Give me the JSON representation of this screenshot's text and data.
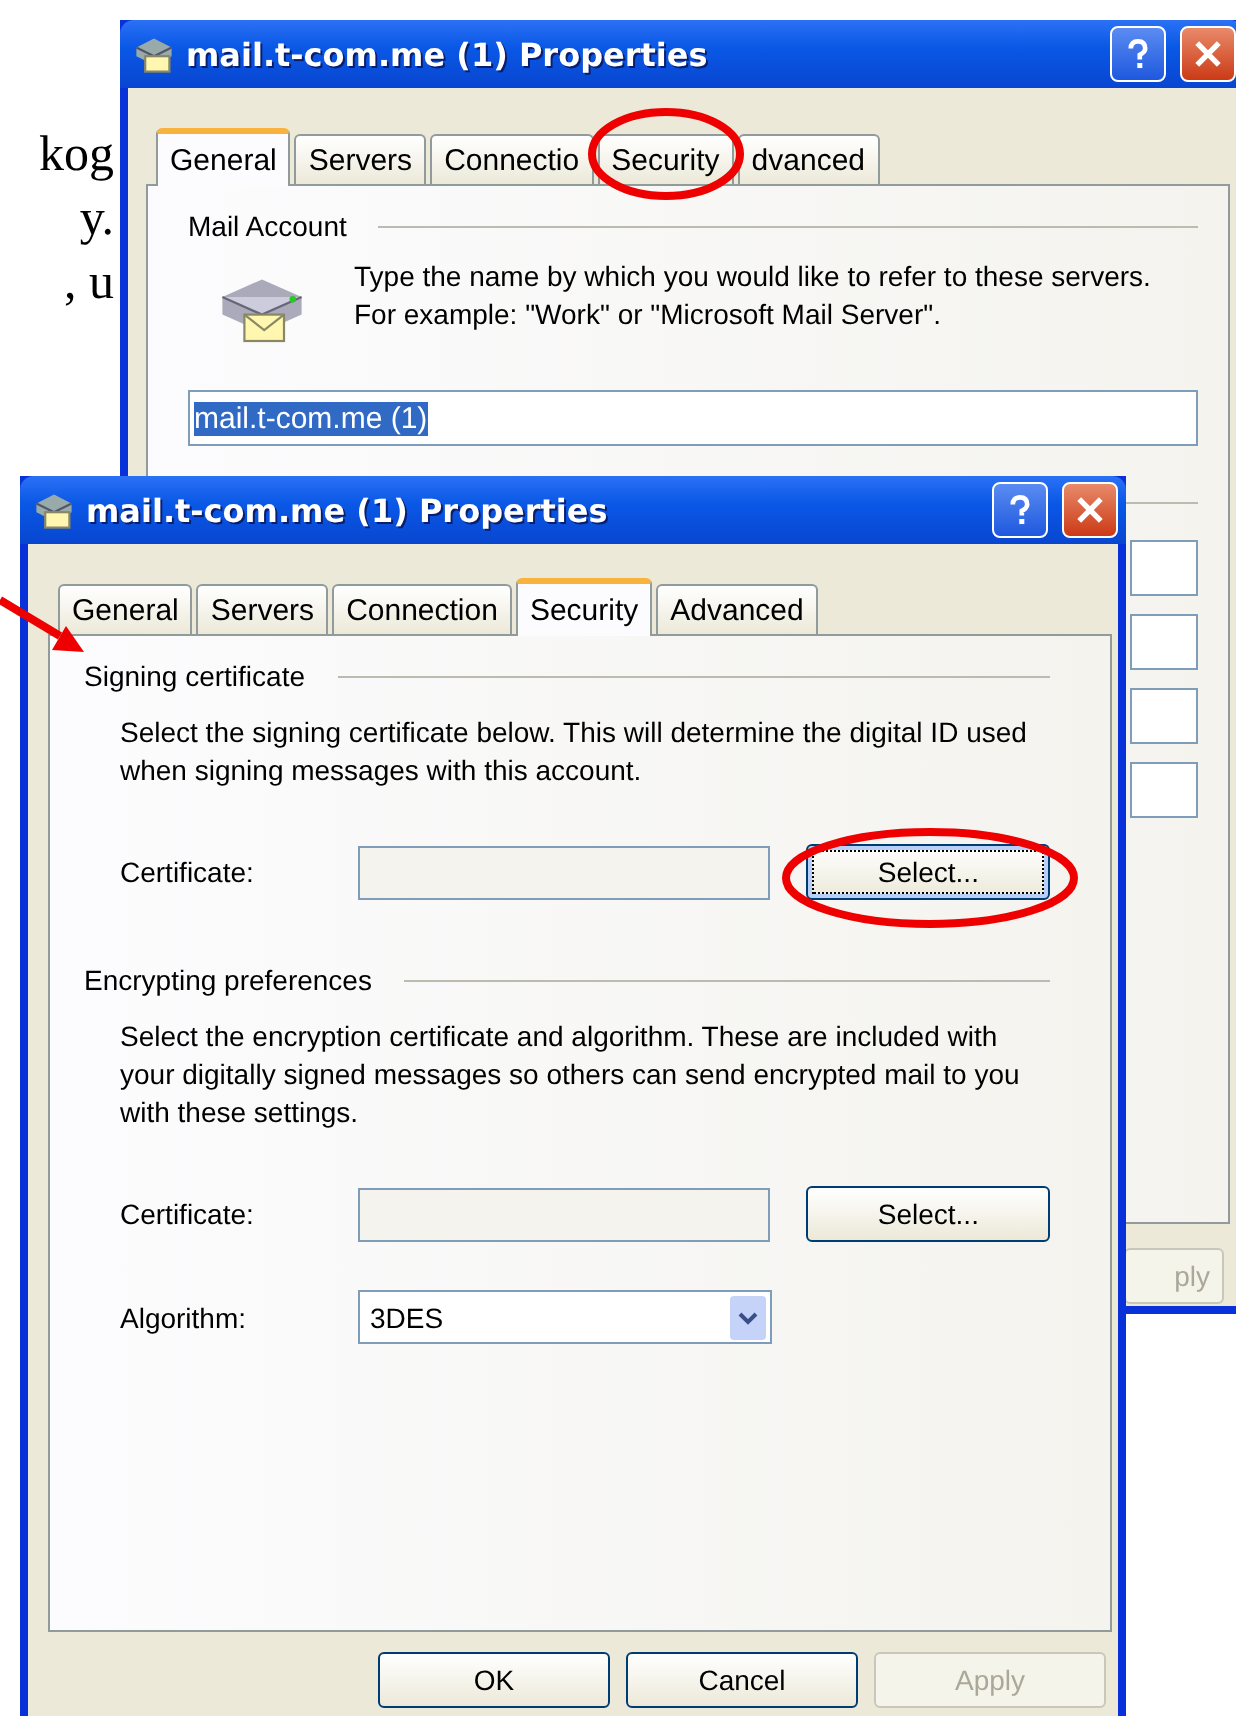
{
  "document_text": [
    "kog",
    "y.",
    ", u"
  ],
  "back_window": {
    "title": "mail.t-com.me (1) Properties",
    "tabs": [
      {
        "label": "General",
        "selected": true
      },
      {
        "label": "Servers",
        "selected": false
      },
      {
        "label": "Connectio",
        "selected": false
      },
      {
        "label": "Security",
        "selected": false
      },
      {
        "label": "dvanced",
        "selected": false
      }
    ],
    "group_title": "Mail Account",
    "description": "Type the name by which you would like to refer to these servers.  For example: \"Work\" or \"Microsoft Mail Server\".",
    "account_name": {
      "value": "mail.t-com.me (1)",
      "selected": true
    },
    "apply_button": {
      "label": "ply",
      "disabled": true
    }
  },
  "front_window": {
    "title": "mail.t-com.me (1) Properties",
    "tabs": [
      {
        "label": "General",
        "selected": false
      },
      {
        "label": "Servers",
        "selected": false
      },
      {
        "label": "Connection",
        "selected": false
      },
      {
        "label": "Security",
        "selected": true
      },
      {
        "label": "Advanced",
        "selected": false
      }
    ],
    "sections": [
      {
        "title": "Signing certificate",
        "description": "Select the signing certificate below. This will determine the digital  ID used when signing messages with this account.",
        "certificate_label": "Certificate:",
        "select_button": {
          "label": "Select...",
          "focused": true
        }
      },
      {
        "title": "Encrypting preferences",
        "description": "Select the encryption certificate and algorithm. These are included with your digitally signed messages so others can send encrypted mail to you with these settings.",
        "certificate_label": "Certificate:",
        "select_button": {
          "label": "Select...",
          "focused": false
        },
        "algorithm_label": "Algorithm:",
        "algorithm": "3DES"
      }
    ],
    "buttons": [
      {
        "label": "OK",
        "disabled": false
      },
      {
        "label": "Cancel",
        "disabled": false
      },
      {
        "label": "Apply",
        "disabled": true
      }
    ]
  }
}
